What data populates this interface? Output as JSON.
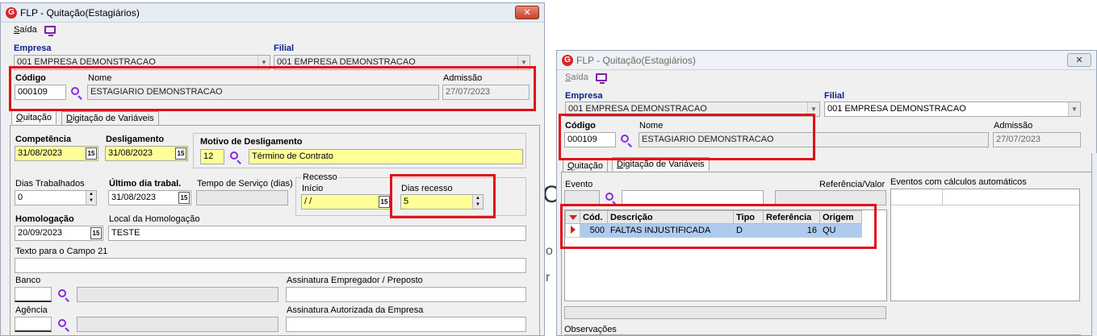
{
  "window1": {
    "title": "FLP - Quitação(Estagiários)",
    "close_glyph": "✕",
    "menu": {
      "saida_u": "S",
      "saida_rest": "aída"
    },
    "empresa": {
      "label": "Empresa",
      "value": "001 EMPRESA DEMONSTRACAO"
    },
    "filial": {
      "label": "Filial",
      "value": "001 EMPRESA DEMONSTRACAO"
    },
    "codigo": {
      "label": "Código",
      "value": "000109"
    },
    "nome": {
      "label": "Nome",
      "value": "ESTAGIARIO DEMONSTRACAO"
    },
    "admissao": {
      "label": "Admissão",
      "value": "27/07/2023"
    },
    "tabs": [
      {
        "u": "Q",
        "rest": "uitação"
      },
      {
        "u": "D",
        "rest": "igitação de Variáveis"
      }
    ],
    "competencia": {
      "label": "Competência",
      "value": "31/08/2023"
    },
    "desligamento": {
      "label": "Desligamento",
      "value": "31/08/2023"
    },
    "motivo": {
      "label": "Motivo de Desligamento",
      "code": "12",
      "desc": "Término de Contrato"
    },
    "dias_trabalhados": {
      "label": "Dias Trabalhados",
      "value": "0"
    },
    "ultimo_dia": {
      "label": "Último dia trabal.",
      "value": "31/08/2023"
    },
    "tempo_servico": {
      "label": "Tempo de Serviço (dias)",
      "value": ""
    },
    "recesso": {
      "label": "Recesso",
      "inicio_label": "Início",
      "inicio_value": " / /"
    },
    "dias_recesso": {
      "label": "Dias recesso",
      "value": "5"
    },
    "homologacao": {
      "label": "Homologação",
      "value": "20/09/2023"
    },
    "local_homologacao": {
      "label": "Local da Homologação",
      "value": "TESTE"
    },
    "texto_campo21": {
      "label": "Texto para o Campo 21",
      "value": ""
    },
    "banco": {
      "label": "Banco",
      "value": ""
    },
    "agencia": {
      "label": "Agência",
      "value": ""
    },
    "assinatura_empregador": {
      "label": "Assinatura Empregador / Preposto",
      "value": ""
    },
    "assinatura_autorizada": {
      "label": "Assinatura Autorizada da Empresa",
      "value": ""
    },
    "cal_glyph": "15"
  },
  "window2": {
    "title": "FLP - Quitação(Estagiários)",
    "close_glyph": "✕",
    "menu": {
      "saida_u": "S",
      "saida_rest": "aída"
    },
    "empresa": {
      "label": "Empresa",
      "value": "001 EMPRESA DEMONSTRACAO"
    },
    "filial": {
      "label": "Filial",
      "value": "001 EMPRESA DEMONSTRACAO"
    },
    "codigo": {
      "label": "Código",
      "value": "000109"
    },
    "nome": {
      "label": "Nome",
      "value": "ESTAGIARIO DEMONSTRACAO"
    },
    "admissao": {
      "label": "Admissão",
      "value": "27/07/2023"
    },
    "tabs": [
      {
        "u": "Q",
        "rest": "uitação"
      },
      {
        "u": "D",
        "rest": "igitação de Variáveis"
      }
    ],
    "evento": {
      "label": "Evento",
      "value": ""
    },
    "referencia_valor": {
      "label": "Referência/Valor",
      "value": ""
    },
    "eventos_calculos": {
      "label": "Eventos com cálculos automáticos"
    },
    "grid": {
      "headers": [
        "Cód.",
        "Descrição",
        "Tipo",
        "Referência",
        "Origem"
      ],
      "rows": [
        {
          "cod": "500",
          "descricao": "FALTAS INJUSTIFICADA",
          "tipo": "D",
          "referencia": "16",
          "origem": "QU"
        }
      ]
    },
    "observacoes": {
      "label": "Observações"
    }
  },
  "background": {
    "fragment_1": "C",
    "fragment_2": "o",
    "fragment_3": "r"
  },
  "colors": {
    "highlight": "#e0101a",
    "required_field": "#ffff99",
    "selected_row": "#aecbef",
    "accent": "#8a2be2"
  }
}
